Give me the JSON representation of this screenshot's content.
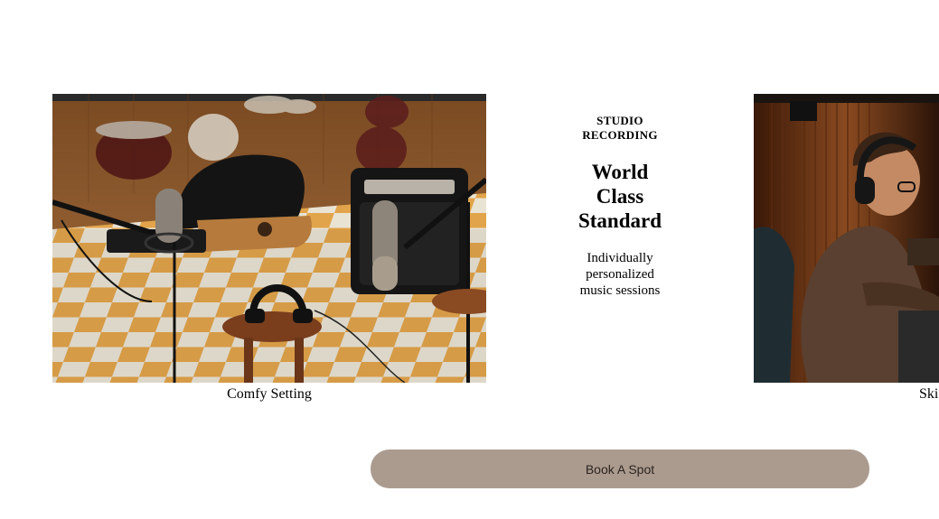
{
  "gallery": {
    "items": [
      {
        "caption": "Comfy Setting"
      },
      {
        "caption": "Ski"
      }
    ]
  },
  "feature": {
    "eyebrow": "STUDIO RECORDING",
    "headline": "World Class Standard",
    "subtext": "Individually personalized music sessions"
  },
  "cta": {
    "label": "Book A Spot"
  },
  "colors": {
    "button_bg": "#ab9b8e",
    "floor_orange": "#e2a44a",
    "floor_cream": "#e9e3d4",
    "wood": "#8a5a33"
  }
}
